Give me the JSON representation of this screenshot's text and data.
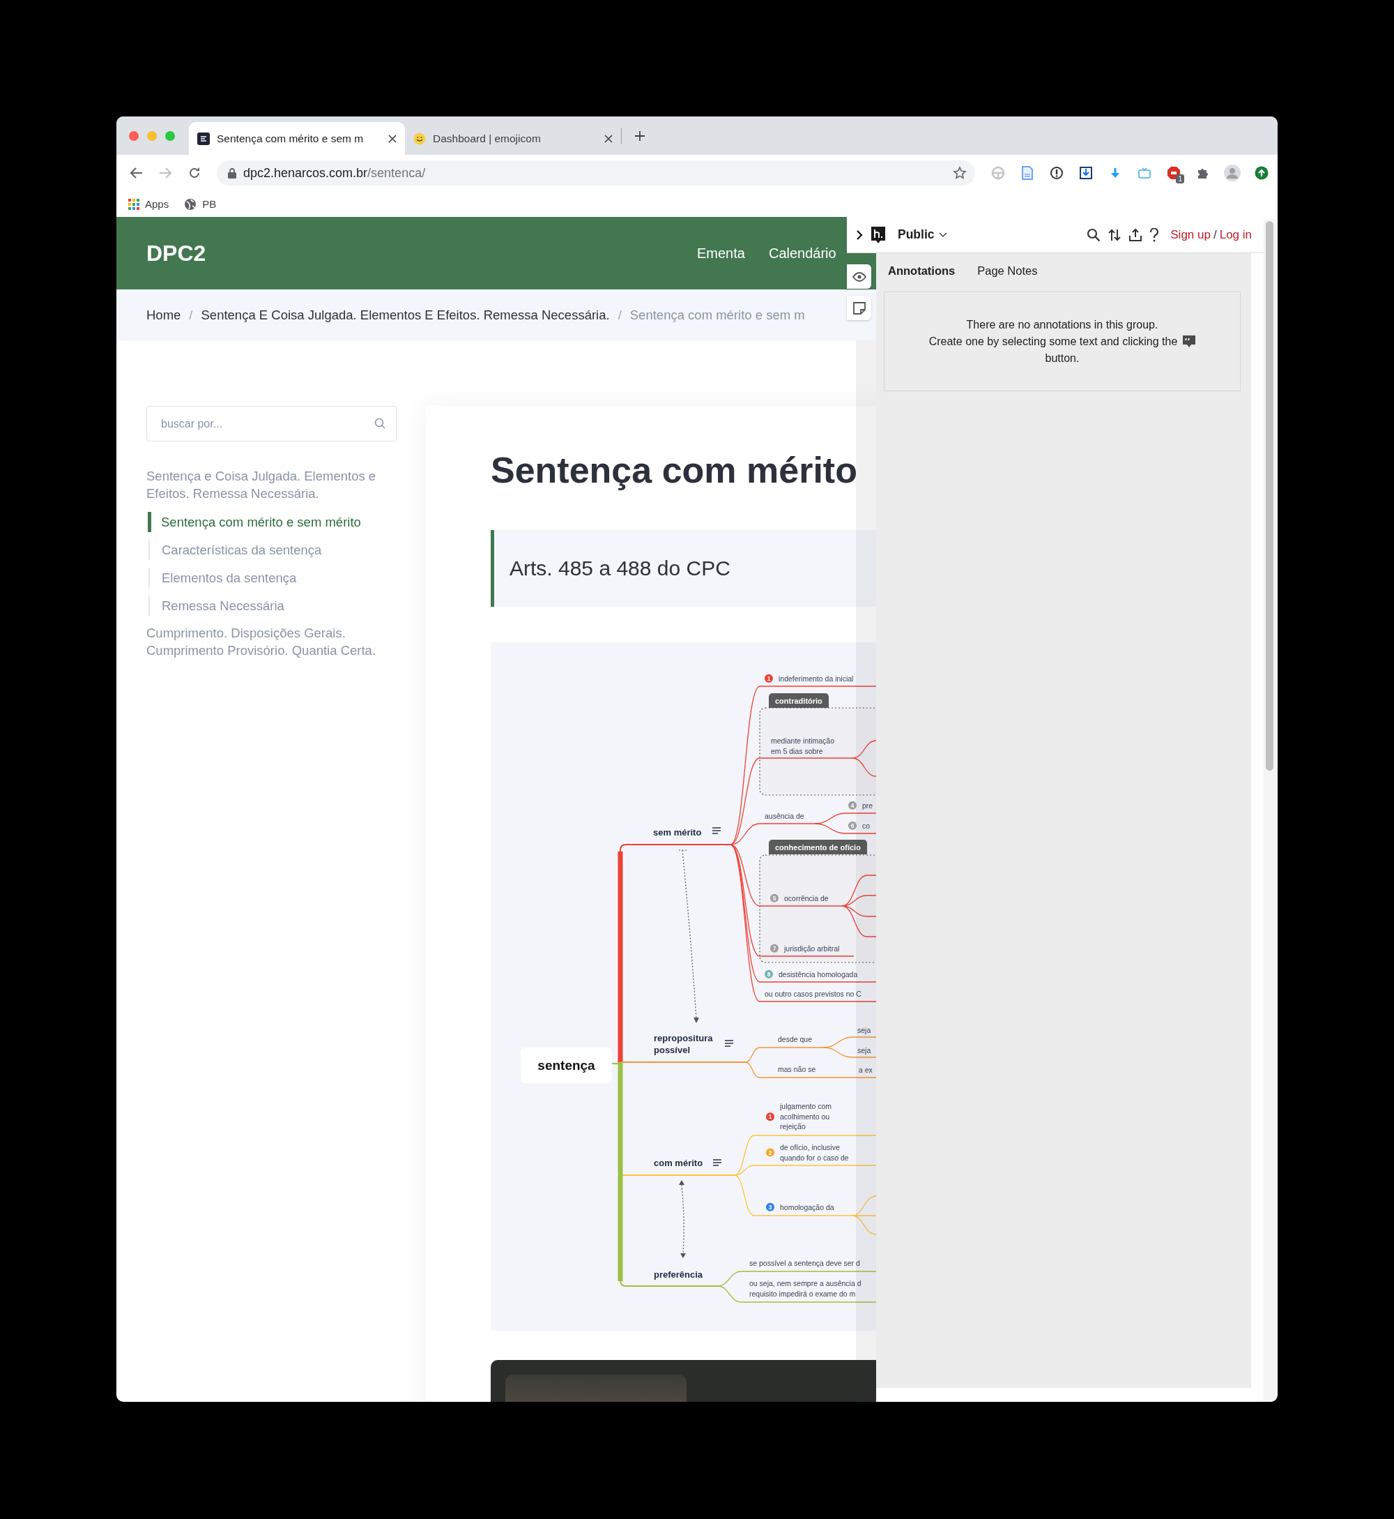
{
  "browser": {
    "tabs": [
      {
        "title": "Sentença com mérito e sem m",
        "selected": true
      },
      {
        "title": "Dashboard | emojicom",
        "selected": false
      }
    ],
    "url_host": "dpc2.henarcos.com.br",
    "url_path": "/sentenca/",
    "forward_disabled": true,
    "extension_badge": "1",
    "bookmarks": [
      "Apps",
      "PB"
    ]
  },
  "site": {
    "logo": "DPC2",
    "nav": [
      "Ementa",
      "Calendário"
    ]
  },
  "breadcrumb": {
    "separator": "/",
    "items": [
      "Home",
      "Sentença E Coisa Julgada. Elementos E Efeitos. Remessa Necessária.",
      "Sentença com mérito e sem m"
    ]
  },
  "sidebar": {
    "search_placeholder": "buscar por...",
    "links": [
      {
        "label": "Sentença e Coisa Julgada. Elementos e Efeitos. Remessa Necessária.",
        "selected": false,
        "children": [
          {
            "label": "Sentença com mérito e sem mérito",
            "selected": true
          },
          {
            "label": "Características da sentença",
            "selected": false
          },
          {
            "label": "Elementos da sentença",
            "selected": false
          },
          {
            "label": "Remessa Necessária",
            "selected": false
          }
        ]
      },
      {
        "label": "Cumprimento. Disposições Gerais. Cumprimento Provisório. Quantia Certa.",
        "selected": false
      }
    ]
  },
  "article": {
    "title": "Sentença com mérito",
    "callout": "Arts. 485 a 488 do CPC",
    "mind_map": {
      "root": "sentença",
      "branches": [
        {
          "label": "sem mérito",
          "notes": true,
          "color": "#ec4136"
        },
        {
          "label": "repropositura\npossível",
          "notes": true,
          "color": "#f39535"
        },
        {
          "label": "com mérito",
          "notes": true,
          "color": "#fcc43c"
        },
        {
          "label": "preferência",
          "notes": false,
          "color": "#9cc046"
        }
      ],
      "groups": [
        "contraditório",
        "conhecimento de ofício"
      ],
      "topics": [
        {
          "label": "indeferimento da inicial",
          "marker": "1",
          "color": "#ec4136"
        },
        {
          "label": "mediante intimação\nem 5 dias sobre"
        },
        {
          "label": "ausência de"
        },
        {
          "label": "pre",
          "marker": "4",
          "color": "#9e9e9e"
        },
        {
          "label": "co",
          "marker": "6",
          "color": "#9e9e9e"
        },
        {
          "label": "ocorrência de",
          "marker": "5",
          "color": "#9e9e9e"
        },
        {
          "label": "jurisdição arbitral",
          "marker": "7",
          "color": "#9e9e9e"
        },
        {
          "label": "desistência homologada",
          "marker": "8",
          "color": "#6fb2b6"
        },
        {
          "label": "ou outro casos previstos no C"
        },
        {
          "label": "desde que"
        },
        {
          "label": "seja"
        },
        {
          "label": "seja"
        },
        {
          "label": "mas não se"
        },
        {
          "label": "a ex"
        },
        {
          "label": "julgamento com\nacolhimento ou\nrejeição",
          "marker": "1",
          "color": "#ec4136"
        },
        {
          "label": "de ofício, inclusive\nquando for o caso de",
          "marker": "2",
          "color": "#f5a623"
        },
        {
          "label": "homologação da",
          "marker": "3",
          "color": "#2f7cf6"
        },
        {
          "label": "se possível a sentença deve ser d"
        },
        {
          "label": "ou seja, nem sempre a ausência d\nrequisito impedirá o exame do m"
        }
      ]
    }
  },
  "annotator": {
    "group": "Public",
    "sign_up": "Sign up",
    "separator": "/",
    "log_in": "Log in",
    "tabs": [
      {
        "label": "Annotations",
        "selected": true
      },
      {
        "label": "Page Notes",
        "selected": false
      }
    ],
    "empty_message": [
      "There are no annotations in this group.",
      "Create one by selecting some text and clicking the",
      "button."
    ]
  }
}
